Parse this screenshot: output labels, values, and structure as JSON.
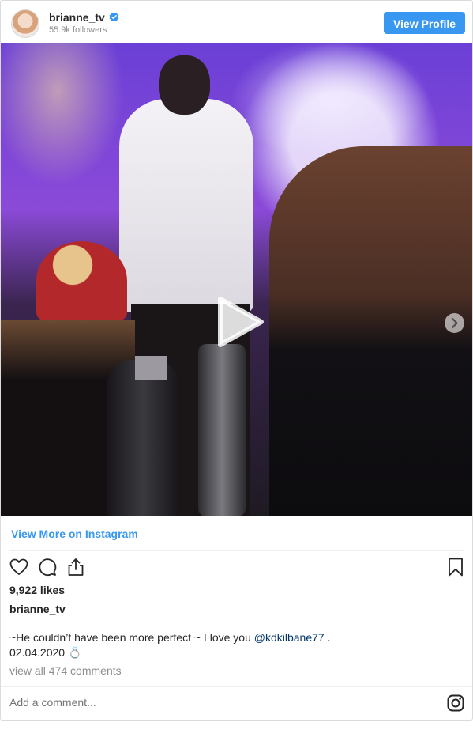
{
  "header": {
    "username": "brianne_tv",
    "followers": "55.9k followers",
    "view_profile_label": "View Profile",
    "verified_icon": "verified-badge-icon",
    "accent_color": "#3897f0"
  },
  "media": {
    "type": "video-carousel",
    "play_icon": "play-icon",
    "next_icon": "chevron-right-icon",
    "slide_count": 2,
    "active_slide": 1
  },
  "links": {
    "view_more": "View More on Instagram"
  },
  "actions": {
    "like_icon": "heart-icon",
    "comment_icon": "comment-icon",
    "share_icon": "share-icon",
    "save_icon": "bookmark-icon"
  },
  "post": {
    "likes": "9,922 likes",
    "author": "brianne_tv",
    "caption_text": "~He couldn’t have been more perfect ~ I love you ",
    "mention": "@kdkilbane77",
    "caption_tail": " .\n02.04.2020 💍",
    "view_comments": "view all 474 comments"
  },
  "comment_box": {
    "placeholder": "Add a comment...",
    "instagram_icon": "instagram-logo-icon"
  }
}
